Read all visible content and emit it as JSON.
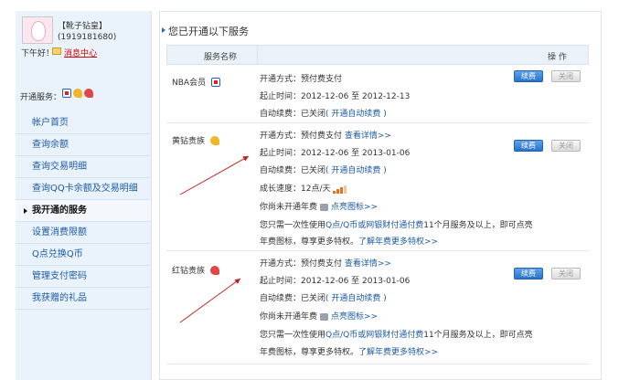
{
  "user": {
    "name": "【靴子钻皇】",
    "qq": "(1919181680)",
    "greeting": "下午好！",
    "message_center": "消息中心"
  },
  "sidebar": {
    "opened_label": "开通服务：",
    "menu": [
      {
        "label": "帐户首页"
      },
      {
        "label": "查询余额"
      },
      {
        "label": "查询交易明细"
      },
      {
        "label": "查询QQ卡余额及交易明细"
      },
      {
        "label": "我开通的服务"
      },
      {
        "label": "设置消费限额"
      },
      {
        "label": "Q点兑换Q币"
      },
      {
        "label": "管理支付密码"
      },
      {
        "label": "我获赠的礼品"
      }
    ]
  },
  "main": {
    "section_title": "您已开通以下服务",
    "table": {
      "col_service": "服务名称",
      "col_operation": "操  作"
    },
    "services": [
      {
        "name": "NBA会员",
        "pay_method": "开通方式：预付费支付",
        "period": "起止时间：2012-12-06 至 2012-12-13",
        "auto_renew": "自动续费：已关闭",
        "auto_renew_link": "( 开通自动续费 )",
        "renew_label": "续费",
        "close_label": "关闭"
      },
      {
        "name": "黄钻贵族",
        "pay_method": "开通方式：预付费支付",
        "details_link": "查看详情>>",
        "period": "起止时间：2012-12-06 至 2013-01-06",
        "auto_renew": "自动续费：已关闭",
        "auto_renew_link": "( 开通自动续费 )",
        "growth": "成长速度：12点/天",
        "annual_text": "你尚未开通年费",
        "annual_link": "点亮图标>>",
        "promo_line1_a": "您只需一次性使用",
        "promo_line1_link": "Q点/Q币或网银财付通付费",
        "promo_line1_b": "11个月服务及以上，即可点亮",
        "promo_line2_a": "年费图标，尊享更多特权。",
        "promo_line2_link": "了解年费更多特权>>",
        "renew_label": "续费",
        "close_label": "关闭"
      },
      {
        "name": "红钻贵族",
        "pay_method": "开通方式：预付费支付",
        "details_link": "查看详情>>",
        "period": "起止时间：2012-12-06 至 2013-01-06",
        "auto_renew": "自动续费：已关闭",
        "auto_renew_link": "( 开通自动续费 )",
        "annual_text": "你尚未开通年费",
        "annual_link": "点亮图标>>",
        "promo_line1_a": "您只需一次性使用",
        "promo_line1_link": "Q点/Q币或网银财付通付费",
        "promo_line1_b": "11个月服务及以上，即可点亮",
        "promo_line2_a": "年费图标，尊享更多特权。",
        "promo_line2_link": "了解年费更多特权>>",
        "renew_label": "续费",
        "close_label": "关闭"
      }
    ]
  },
  "colors": {
    "accent": "#2a72c7",
    "sidebar_bg": "#eaf3fb",
    "arrow": "#c0201f"
  }
}
